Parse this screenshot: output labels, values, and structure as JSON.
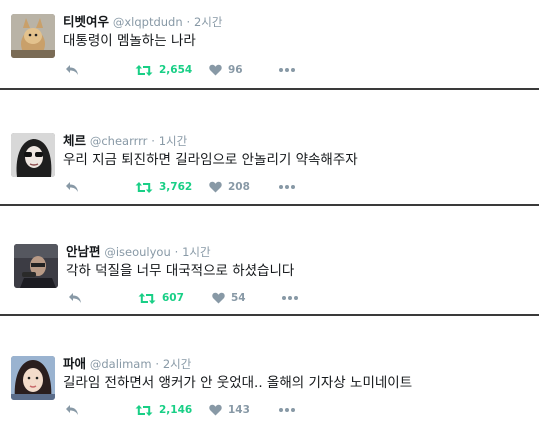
{
  "colors": {
    "retweet": "#19cf86",
    "muted": "#8899a6",
    "divider": "#3a3a3a"
  },
  "tweets": [
    {
      "name": "티벳여우",
      "handle": "@xlqptdudn",
      "time": "2시간",
      "text": "대통령이 멤놀하는 나라",
      "retweets": "2,654",
      "likes": "96"
    },
    {
      "name": "체르",
      "handle": "@chearrrr",
      "time": "1시간",
      "text": "우리 지금 퇴진하면 길라임으로 안놀리기 약속해주자",
      "retweets": "3,762",
      "likes": "208"
    },
    {
      "name": "안남편",
      "handle": "@iseoulyou",
      "time": "1시간",
      "text": "각하 덕질을 너무 대국적으로 하셨습니다",
      "retweets": "607",
      "likes": "54"
    },
    {
      "name": "파애",
      "handle": "@dalimam",
      "time": "2시간",
      "text": "길라임 전하면서 앵커가 안 웃었대.. 올해의 기자상 노미네이트",
      "retweets": "2,146",
      "likes": "143"
    }
  ],
  "separator": "·",
  "icons": {
    "reply": "reply-icon",
    "retweet": "retweet-icon",
    "like": "heart-icon",
    "more": "more-icon"
  }
}
